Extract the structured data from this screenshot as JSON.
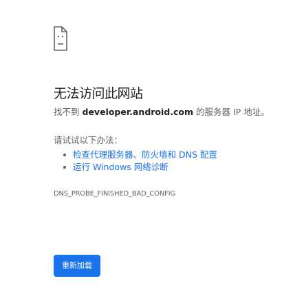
{
  "page": {
    "icon": "sad-page-icon",
    "title": "无法访问此网站",
    "description_prefix": "找不到",
    "host": "developer.android.com",
    "description_suffix": "的服务器 IP 地址。",
    "suggestions_label": "请试试以下办法：",
    "suggestions": [
      {
        "link": "检查代理服务器、防火墙和 DNS 配置",
        "text": ""
      },
      {
        "link": "运行 Windows 网络诊断",
        "text": ""
      }
    ],
    "error_code": "DNS_PROBE_FINISHED_BAD_CONFIG",
    "reload_label": "重新加载"
  },
  "colors": {
    "accent": "#1a73e8",
    "text": "#202124",
    "secondary_text": "#5f6368"
  }
}
